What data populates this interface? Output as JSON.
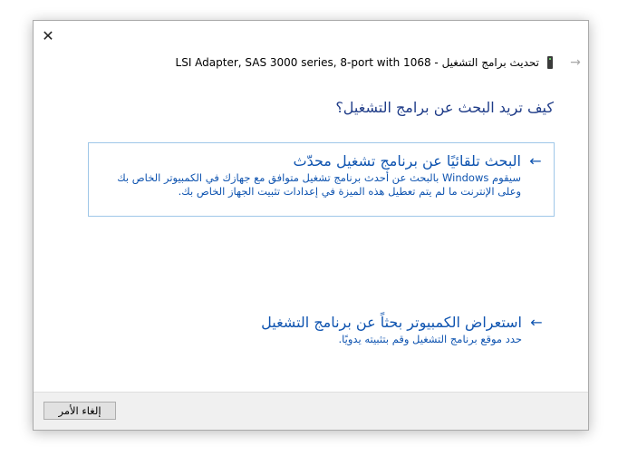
{
  "window": {
    "close_glyph": "✕",
    "back_glyph": "→",
    "title": "تحديث برامج التشغيل - LSI Adapter, SAS 3000 series, 8-port with 1068",
    "question": "كيف تريد البحث عن برامج التشغيل؟"
  },
  "options": [
    {
      "arrow": "←",
      "title": "البحث تلقائيًا عن برنامج تشغيل محدّث",
      "description": "سيقوم Windows بالبحث عن أحدث برنامج تشغيل متوافق مع جهازك في الكمبيوتر الخاص بك وعلى الإنترنت ما لم يتم تعطيل هذه الميزة في إعدادات تثبيت الجهاز الخاص بك."
    },
    {
      "arrow": "←",
      "title": "استعراض الكمبيوتر بحثاً عن برنامج التشغيل",
      "description": "حدد موقع برنامج التشغيل وقم بتثبيته يدويًا."
    }
  ],
  "footer": {
    "cancel_label": "إلغاء الأمر"
  },
  "colors": {
    "link": "#0f54b0",
    "heading": "#1f3c88",
    "option_border": "#9fc7e8"
  },
  "icons": {
    "close": "close-icon",
    "back": "back-arrow-icon",
    "device": "device-icon",
    "option_arrow": "arrow-left-icon"
  }
}
